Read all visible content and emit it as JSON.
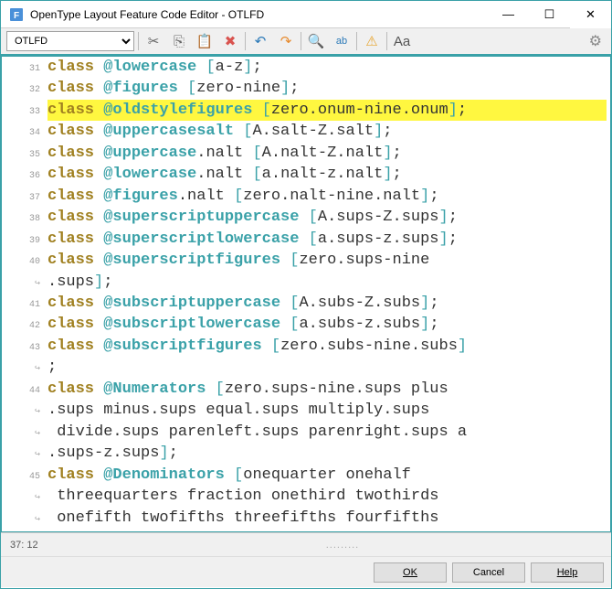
{
  "window": {
    "title": "OpenType Layout Feature Code Editor - OTLFD",
    "min": "—",
    "max": "☐",
    "close": "✕"
  },
  "toolbar": {
    "dropdown_value": "OTLFD",
    "icons": {
      "cut": "✂",
      "copy": "⎘",
      "paste": "📋",
      "delete": "✖",
      "undo": "↶",
      "redo": "↷",
      "find": "🔍",
      "replace": "ab",
      "warn": "⚠",
      "case": "Aa",
      "gear": "⚙"
    }
  },
  "code": {
    "lines": [
      {
        "n": 31,
        "hl": false,
        "parts": [
          [
            "kw",
            "class"
          ],
          [
            "sp",
            " "
          ],
          [
            "cls",
            "@lowercase"
          ],
          [
            "sp",
            " "
          ],
          [
            "brk",
            "["
          ],
          [
            "txt",
            "a"
          ],
          [
            "punc",
            "-"
          ],
          [
            "txt",
            "z"
          ],
          [
            "brk",
            "]"
          ],
          [
            "punc",
            ";"
          ]
        ]
      },
      {
        "n": 32,
        "hl": false,
        "parts": [
          [
            "kw",
            "class"
          ],
          [
            "sp",
            " "
          ],
          [
            "cls",
            "@figures"
          ],
          [
            "sp",
            " "
          ],
          [
            "brk",
            "["
          ],
          [
            "txt",
            "zero"
          ],
          [
            "punc",
            "-"
          ],
          [
            "txt",
            "nine"
          ],
          [
            "brk",
            "]"
          ],
          [
            "punc",
            ";"
          ]
        ]
      },
      {
        "n": 33,
        "hl": true,
        "parts": [
          [
            "kw",
            "class"
          ],
          [
            "sp",
            " "
          ],
          [
            "cls",
            "@oldstylefigures"
          ],
          [
            "sp",
            " "
          ],
          [
            "brk",
            "["
          ],
          [
            "txt",
            "zero.onum"
          ],
          [
            "punc",
            "-"
          ],
          [
            "txt",
            "nine.onum"
          ],
          [
            "brk",
            "]"
          ],
          [
            "punc",
            ";"
          ]
        ]
      },
      {
        "n": 34,
        "hl": false,
        "parts": [
          [
            "kw",
            "class"
          ],
          [
            "sp",
            " "
          ],
          [
            "cls",
            "@uppercasesalt"
          ],
          [
            "sp",
            " "
          ],
          [
            "brk",
            "["
          ],
          [
            "txt",
            "A.salt"
          ],
          [
            "punc",
            "-"
          ],
          [
            "txt",
            "Z.salt"
          ],
          [
            "brk",
            "]"
          ],
          [
            "punc",
            ";"
          ]
        ]
      },
      {
        "n": 35,
        "hl": false,
        "parts": [
          [
            "kw",
            "class"
          ],
          [
            "sp",
            " "
          ],
          [
            "cls",
            "@uppercase"
          ],
          [
            "txt",
            ".nalt "
          ],
          [
            "brk",
            "["
          ],
          [
            "txt",
            "A.nalt"
          ],
          [
            "punc",
            "-"
          ],
          [
            "txt",
            "Z.nalt"
          ],
          [
            "brk",
            "]"
          ],
          [
            "punc",
            ";"
          ]
        ]
      },
      {
        "n": 36,
        "hl": false,
        "parts": [
          [
            "kw",
            "class"
          ],
          [
            "sp",
            " "
          ],
          [
            "cls",
            "@lowercase"
          ],
          [
            "txt",
            ".nalt "
          ],
          [
            "brk",
            "["
          ],
          [
            "txt",
            "a.nalt"
          ],
          [
            "punc",
            "-"
          ],
          [
            "txt",
            "z.nalt"
          ],
          [
            "brk",
            "]"
          ],
          [
            "punc",
            ";"
          ]
        ]
      },
      {
        "n": 37,
        "hl": false,
        "parts": [
          [
            "kw",
            "class"
          ],
          [
            "sp",
            " "
          ],
          [
            "cls",
            "@figures"
          ],
          [
            "txt",
            ".nalt "
          ],
          [
            "brk",
            "["
          ],
          [
            "txt",
            "zero.nalt"
          ],
          [
            "punc",
            "-"
          ],
          [
            "txt",
            "nine.nalt"
          ],
          [
            "brk",
            "]"
          ],
          [
            "punc",
            ";"
          ]
        ]
      },
      {
        "n": 38,
        "hl": false,
        "parts": [
          [
            "kw",
            "class"
          ],
          [
            "sp",
            " "
          ],
          [
            "cls",
            "@superscriptuppercase"
          ],
          [
            "sp",
            " "
          ],
          [
            "brk",
            "["
          ],
          [
            "txt",
            "A.sups"
          ],
          [
            "punc",
            "-"
          ],
          [
            "txt",
            "Z.sups"
          ],
          [
            "brk",
            "]"
          ],
          [
            "punc",
            ";"
          ]
        ]
      },
      {
        "n": 39,
        "hl": false,
        "parts": [
          [
            "kw",
            "class"
          ],
          [
            "sp",
            " "
          ],
          [
            "cls",
            "@superscriptlowercase"
          ],
          [
            "sp",
            " "
          ],
          [
            "brk",
            "["
          ],
          [
            "txt",
            "a.sups"
          ],
          [
            "punc",
            "-"
          ],
          [
            "txt",
            "z.sups"
          ],
          [
            "brk",
            "]"
          ],
          [
            "punc",
            ";"
          ]
        ]
      },
      {
        "n": 40,
        "hl": false,
        "parts": [
          [
            "kw",
            "class"
          ],
          [
            "sp",
            " "
          ],
          [
            "cls",
            "@superscriptfigures"
          ],
          [
            "sp",
            " "
          ],
          [
            "brk",
            "["
          ],
          [
            "txt",
            "zero.sups"
          ],
          [
            "punc",
            "-"
          ],
          [
            "txt",
            "nine"
          ]
        ]
      },
      {
        "n": "w",
        "hl": false,
        "parts": [
          [
            "txt",
            ".sups"
          ],
          [
            "brk",
            "]"
          ],
          [
            "punc",
            ";"
          ]
        ]
      },
      {
        "n": 41,
        "hl": false,
        "parts": [
          [
            "kw",
            "class"
          ],
          [
            "sp",
            " "
          ],
          [
            "cls",
            "@subscriptuppercase"
          ],
          [
            "sp",
            " "
          ],
          [
            "brk",
            "["
          ],
          [
            "txt",
            "A.subs"
          ],
          [
            "punc",
            "-"
          ],
          [
            "txt",
            "Z.subs"
          ],
          [
            "brk",
            "]"
          ],
          [
            "punc",
            ";"
          ]
        ]
      },
      {
        "n": 42,
        "hl": false,
        "parts": [
          [
            "kw",
            "class"
          ],
          [
            "sp",
            " "
          ],
          [
            "cls",
            "@subscriptlowercase"
          ],
          [
            "sp",
            " "
          ],
          [
            "brk",
            "["
          ],
          [
            "txt",
            "a.subs"
          ],
          [
            "punc",
            "-"
          ],
          [
            "txt",
            "z.subs"
          ],
          [
            "brk",
            "]"
          ],
          [
            "punc",
            ";"
          ]
        ]
      },
      {
        "n": 43,
        "hl": false,
        "parts": [
          [
            "kw",
            "class"
          ],
          [
            "sp",
            " "
          ],
          [
            "cls",
            "@subscriptfigures"
          ],
          [
            "sp",
            " "
          ],
          [
            "brk",
            "["
          ],
          [
            "txt",
            "zero.subs"
          ],
          [
            "punc",
            "-"
          ],
          [
            "txt",
            "nine.subs"
          ],
          [
            "brk",
            "]"
          ]
        ]
      },
      {
        "n": "w",
        "hl": false,
        "parts": [
          [
            "punc",
            ";"
          ]
        ]
      },
      {
        "n": 44,
        "hl": false,
        "parts": [
          [
            "kw",
            "class"
          ],
          [
            "sp",
            " "
          ],
          [
            "cls",
            "@Numerators"
          ],
          [
            "sp",
            " "
          ],
          [
            "brk",
            "["
          ],
          [
            "txt",
            "zero.sups"
          ],
          [
            "punc",
            "-"
          ],
          [
            "txt",
            "nine.sups plus"
          ]
        ]
      },
      {
        "n": "w",
        "hl": false,
        "parts": [
          [
            "txt",
            ".sups minus.sups equal.sups multiply.sups"
          ]
        ]
      },
      {
        "n": "w",
        "hl": false,
        "parts": [
          [
            "txt",
            " divide.sups parenleft.sups parenright.sups a"
          ]
        ]
      },
      {
        "n": "w",
        "hl": false,
        "parts": [
          [
            "txt",
            ".sups"
          ],
          [
            "punc",
            "-"
          ],
          [
            "txt",
            "z.sups"
          ],
          [
            "brk",
            "]"
          ],
          [
            "punc",
            ";"
          ]
        ]
      },
      {
        "n": 45,
        "hl": false,
        "parts": [
          [
            "kw",
            "class"
          ],
          [
            "sp",
            " "
          ],
          [
            "cls",
            "@Denominators"
          ],
          [
            "sp",
            " "
          ],
          [
            "brk",
            "["
          ],
          [
            "txt",
            "onequarter onehalf"
          ]
        ]
      },
      {
        "n": "w",
        "hl": false,
        "parts": [
          [
            "txt",
            " threequarters fraction onethird twothirds"
          ]
        ]
      },
      {
        "n": "w",
        "hl": false,
        "parts": [
          [
            "txt",
            " onefifth twofifths threefifths fourfifths"
          ]
        ]
      }
    ]
  },
  "status": {
    "pos": "37: 12",
    "dots": "........."
  },
  "buttons": {
    "ok": "OK",
    "cancel": "Cancel",
    "help": "Help"
  }
}
